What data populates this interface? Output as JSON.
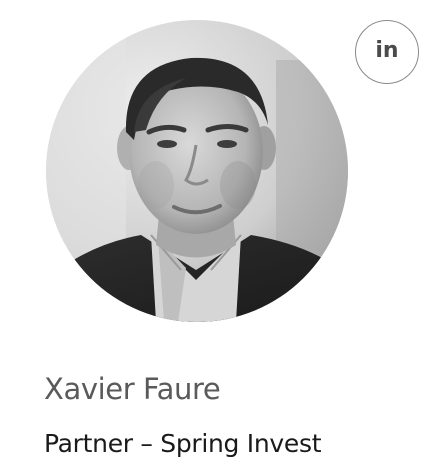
{
  "profile": {
    "name": "Xavier Faure",
    "role": "Partner – Spring Invest",
    "linkedin_label": "in",
    "linkedin_icon": "linkedin-icon"
  },
  "colors": {
    "name_text": "#5a5a5a",
    "role_text": "#1a1a1a",
    "linkedin_border": "#8a8a8a",
    "linkedin_text": "#4b4b4b"
  }
}
